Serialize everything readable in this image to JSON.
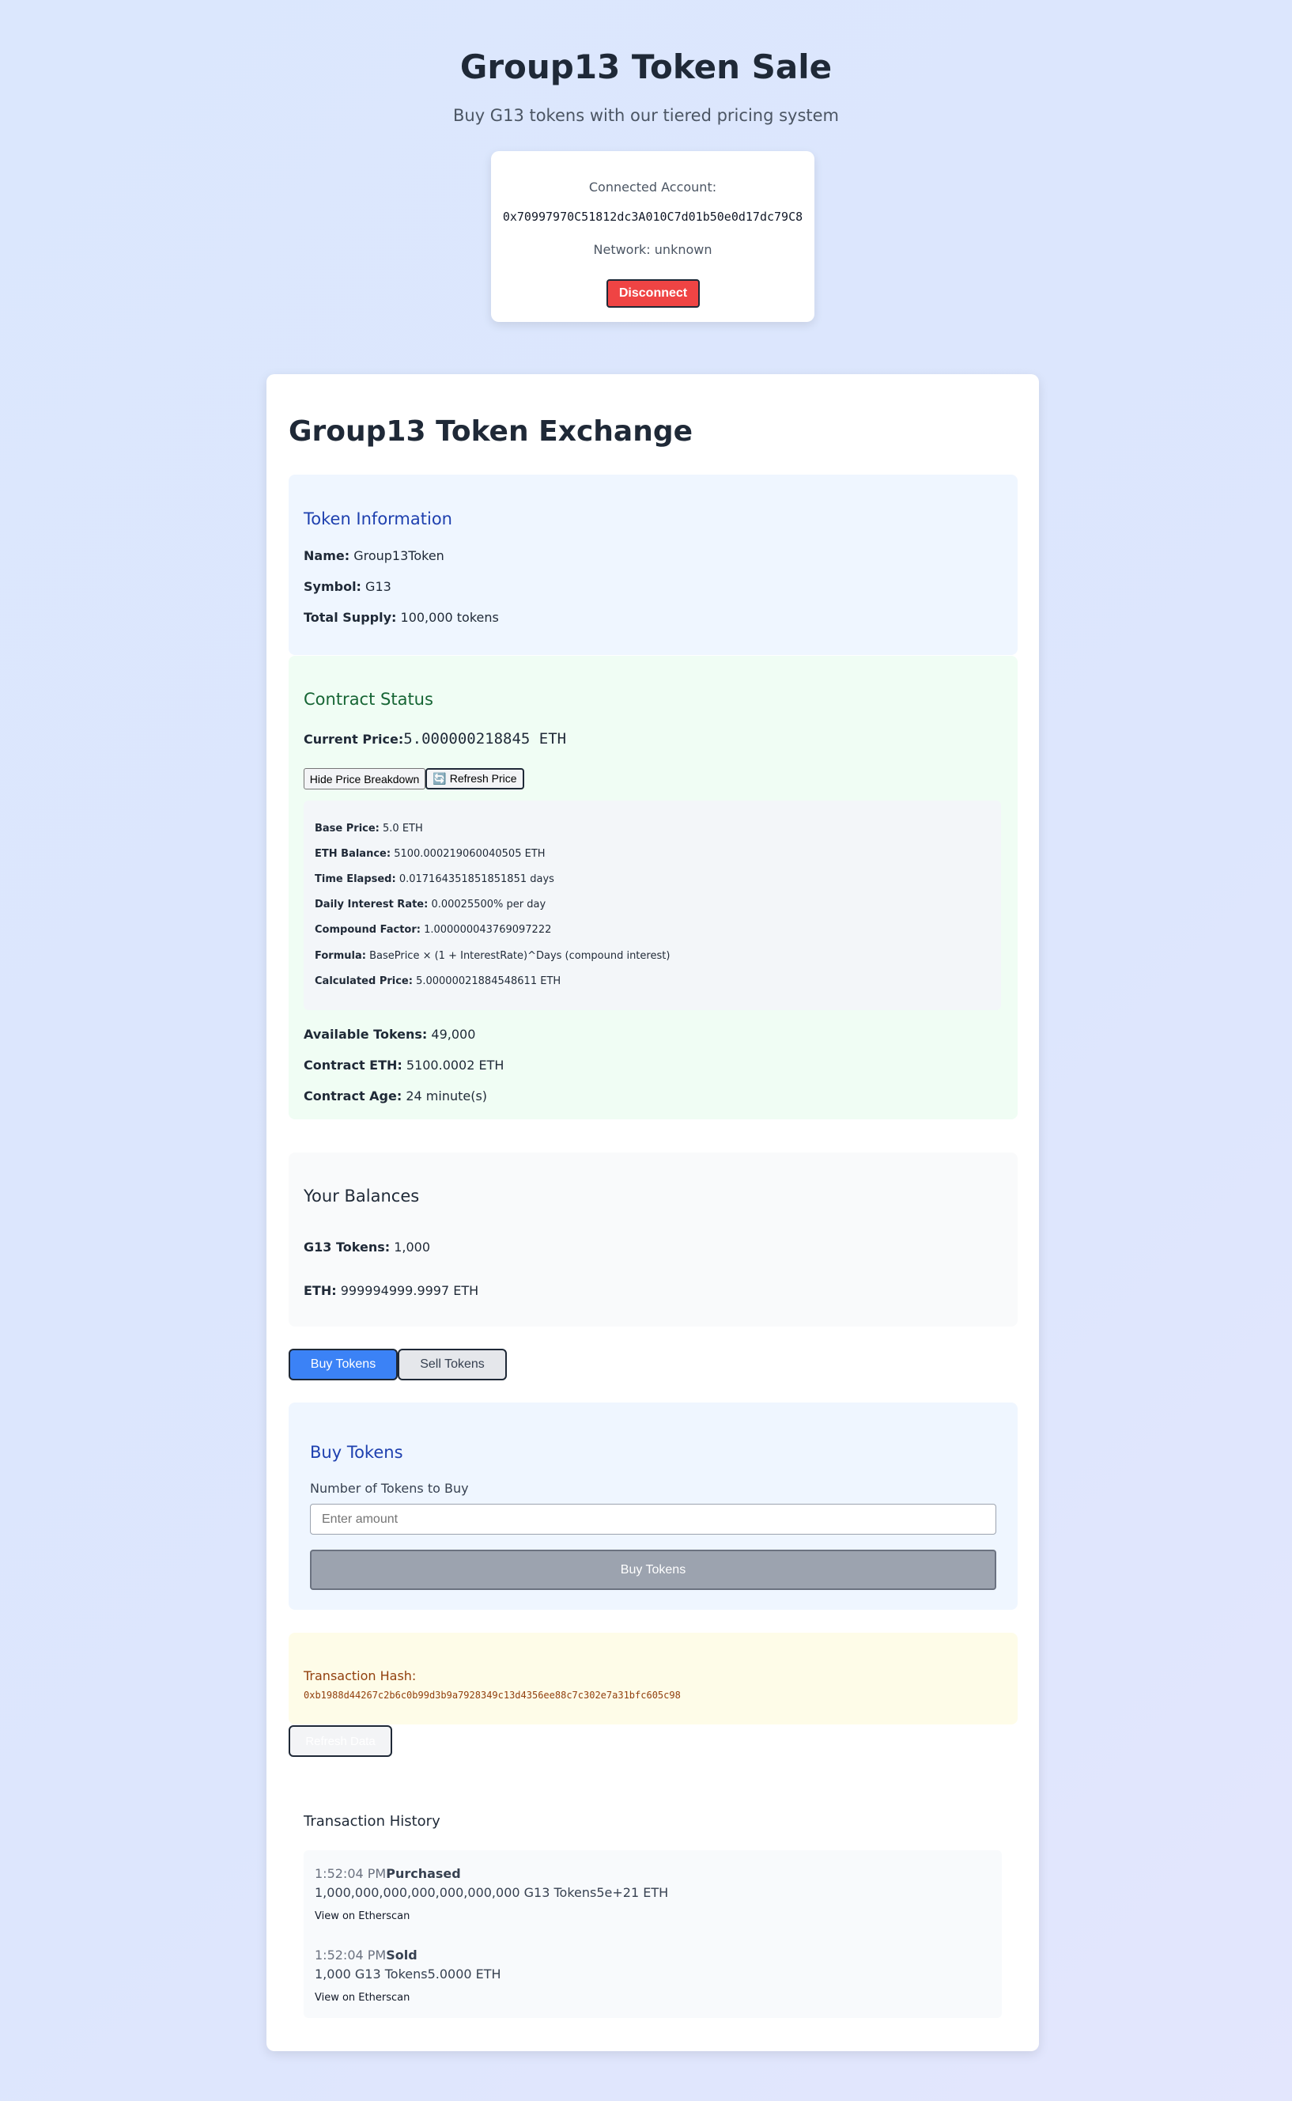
{
  "header": {
    "title": "Group13 Token Sale",
    "subtitle": "Buy G13 tokens with our tiered pricing system"
  },
  "account": {
    "label": "Connected Account:",
    "address": "0x70997970C51812dc3A010C7d01b50e0d17dc79C8",
    "network": "Network: unknown",
    "disconnect_label": "Disconnect"
  },
  "exchange": {
    "title": "Group13 Token Exchange",
    "token_info": {
      "title": "Token Information",
      "name_label": "Name:",
      "name_value": "Group13Token",
      "symbol_label": "Symbol:",
      "symbol_value": "G13",
      "supply_label": "Total Supply:",
      "supply_value": "100,000 tokens"
    },
    "contract_status": {
      "title": "Contract Status",
      "price_label": "Current Price:",
      "price_value": "5.000000218845 ETH",
      "hide_breakdown_label": "Hide Price Breakdown",
      "refresh_icon": "🔄",
      "refresh_label": "Refresh Price",
      "breakdown": {
        "base_price_label": "Base Price:",
        "base_price_value": "5.0 ETH",
        "eth_balance_label": "ETH Balance:",
        "eth_balance_value": "5100.000219060040505 ETH",
        "time_elapsed_label": "Time Elapsed:",
        "time_elapsed_value": "0.017164351851851851 days",
        "daily_rate_label": "Daily Interest Rate:",
        "daily_rate_value": "0.00025500% per day",
        "compound_label": "Compound Factor:",
        "compound_value": "1.000000043769097222",
        "formula_label": "Formula:",
        "formula_value": "BasePrice × (1 + InterestRate)^Days (compound interest)",
        "calculated_label": "Calculated Price:",
        "calculated_value": "5.00000021884548611 ETH"
      },
      "available_label": "Available Tokens:",
      "available_value": "49,000",
      "contract_eth_label": "Contract ETH:",
      "contract_eth_value": "5100.0002 ETH",
      "age_label": "Contract Age:",
      "age_value": "24 minute(s)"
    },
    "balances": {
      "title": "Your Balances",
      "g13_label": "G13 Tokens:",
      "g13_value": "1,000",
      "eth_label": "ETH:",
      "eth_value": "999994999.9997 ETH"
    },
    "tabs": {
      "buy_label": "Buy Tokens",
      "sell_label": "Sell Tokens"
    },
    "buy_form": {
      "title": "Buy Tokens",
      "amount_label": "Number of Tokens to Buy",
      "amount_placeholder": "Enter amount",
      "amount_value": "",
      "submit_label": "Buy Tokens"
    },
    "transaction": {
      "hash_label": "Transaction Hash:",
      "hash_value": "0xb1988d44267c2b6c0b99d3b9a7928349c13d4356ee88c7c302e7a31bfc605c98"
    },
    "refresh_data_label": "Refresh Data",
    "history": {
      "title": "Transaction History",
      "items": [
        {
          "time": "1:52:04 PM",
          "type": "Purchased",
          "detail": "1,000,000,000,000,000,000,000 G13 Tokens5e+21 ETH",
          "link": "View on Etherscan"
        },
        {
          "time": "1:52:04 PM",
          "type": "Sold",
          "detail": "1,000 G13 Tokens5.0000 ETH",
          "link": "View on Etherscan"
        }
      ]
    }
  },
  "colors": {
    "accent_blue": "#3b82f6",
    "danger_red": "#ef4444",
    "token_info_title": "#1e40af",
    "contract_status_title": "#166534",
    "tx_hash": "#92400e"
  }
}
